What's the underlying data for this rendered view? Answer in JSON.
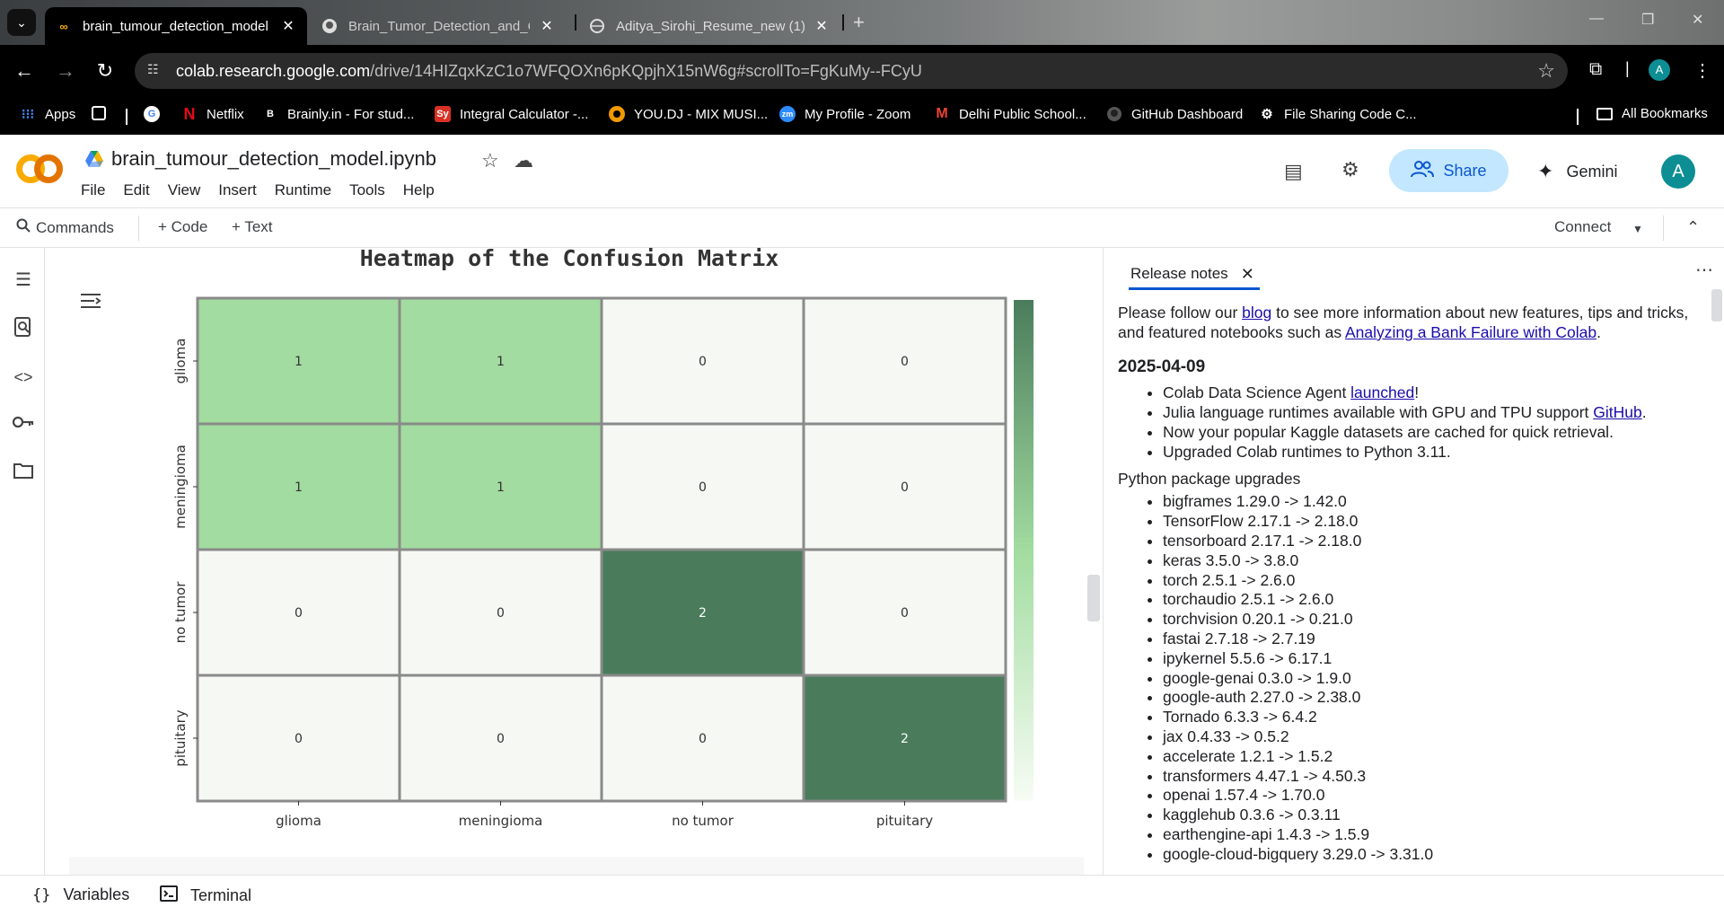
{
  "browser": {
    "tabs": [
      {
        "title": "brain_tumour_detection_model",
        "active": true,
        "icon": "colab-icon"
      },
      {
        "title": "Brain_Tumor_Detection_and_C",
        "active": false,
        "icon": "github-icon"
      },
      {
        "title": "Aditya_Sirohi_Resume_new (1).",
        "active": false,
        "icon": "globe-icon"
      }
    ],
    "url_host": "colab.research.google.com",
    "url_path": "/drive/14HIZqxKzC1o7WFQOXn6pKQpjhX15nW6g#scrollTo=FgKuMy--FCyU",
    "profile_initial": "A"
  },
  "bookmarks": {
    "apps_label": "Apps",
    "items": [
      {
        "label": "Netflix",
        "icon": "netflix-icon"
      },
      {
        "label": "Brainly.in - For stud...",
        "icon": "brainly-icon"
      },
      {
        "label": "Integral Calculator -...",
        "icon": "integral-calculator-icon"
      },
      {
        "label": "YOU.DJ - MIX MUSI...",
        "icon": "youdj-icon"
      },
      {
        "label": "My Profile - Zoom",
        "icon": "zoom-icon"
      },
      {
        "label": "Delhi Public School...",
        "icon": "gmail-icon"
      },
      {
        "label": "GitHub Dashboard",
        "icon": "github-icon"
      },
      {
        "label": "File Sharing Code C...",
        "icon": "gear-icon"
      }
    ],
    "all_bookmarks": "All Bookmarks"
  },
  "colab": {
    "notebook_title": "brain_tumour_detection_model.ipynb",
    "menus": [
      "File",
      "Edit",
      "View",
      "Insert",
      "Runtime",
      "Tools",
      "Help"
    ],
    "share_label": "Share",
    "gemini_label": "Gemini",
    "avatar_initial": "A",
    "commands_label": "Commands",
    "code_label": "+ Code",
    "text_label": "+ Text",
    "connect_label": "Connect"
  },
  "chart_data": {
    "type": "heatmap",
    "title": "Heatmap of the Confusion Matrix",
    "x_categories": [
      "glioma",
      "meningioma",
      "no tumor",
      "pituitary"
    ],
    "y_categories": [
      "glioma",
      "meningioma",
      "no tumor",
      "pituitary"
    ],
    "values": [
      [
        1,
        1,
        0,
        0
      ],
      [
        1,
        1,
        0,
        0
      ],
      [
        0,
        0,
        2,
        0
      ],
      [
        0,
        0,
        0,
        2
      ]
    ],
    "colorbar": {
      "range": [
        0,
        2
      ],
      "ticks": [
        "0.00",
        "0.25",
        "0.50",
        "0.75",
        "1.00",
        "1.25",
        "1.50",
        "1.75",
        "2.00"
      ],
      "color_low": "#f7fcf5",
      "color_mid": "#a1d99b",
      "color_high": "#4a7c59"
    },
    "colors": {
      "low": "#f5f8f3",
      "mid": "#a2dca0",
      "high": "#4a7c5c"
    }
  },
  "release_notes": {
    "tab_label": "Release notes",
    "intro_before_blog": "Please follow our ",
    "blog_link": "blog",
    "intro_after_blog": " to see more information about new features, tips and tricks, and featured notebooks such as ",
    "featured_link": "Analyzing a Bank Failure with Colab",
    "intro_end": ".",
    "date": "2025-04-09",
    "items": [
      {
        "text": "Colab Data Science Agent ",
        "link": "launched",
        "after": "!"
      },
      {
        "text": "Julia language runtimes available with GPU and TPU support ",
        "link": "GitHub",
        "after": "."
      },
      {
        "text": "Now your popular Kaggle datasets are cached for quick retrieval.",
        "link": "",
        "after": ""
      },
      {
        "text": "Upgraded Colab runtimes to Python 3.11.",
        "link": "",
        "after": ""
      }
    ],
    "upgrades_heading": "Python package upgrades",
    "upgrades": [
      "bigframes 1.29.0 -> 1.42.0",
      "TensorFlow 2.17.1 -> 2.18.0",
      "tensorboard 2.17.1 -> 2.18.0",
      "keras 3.5.0 -> 3.8.0",
      "torch 2.5.1 -> 2.6.0",
      "torchaudio 2.5.1 -> 2.6.0",
      "torchvision 0.20.1 -> 0.21.0",
      "fastai 2.7.18 -> 2.7.19",
      "ipykernel 5.5.6 -> 6.17.1",
      "google-genai 0.3.0 -> 1.9.0",
      "google-auth 2.27.0 -> 2.38.0",
      "Tornado 6.3.3 -> 6.4.2",
      "jax 0.4.33 -> 0.5.2",
      "accelerate 1.2.1 -> 1.5.2",
      "transformers 4.47.1 -> 4.50.3",
      "openai 1.57.4 -> 1.70.0",
      "kagglehub 0.3.6 -> 0.3.11",
      "earthengine-api 1.4.3 -> 1.5.9",
      "google-cloud-bigquery 3.29.0 -> 3.31.0"
    ]
  },
  "bottom": {
    "variables_label": "Variables",
    "terminal_label": "Terminal"
  }
}
